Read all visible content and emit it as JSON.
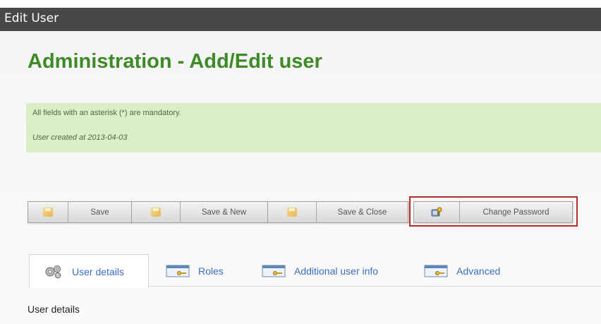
{
  "window": {
    "title": "Edit User"
  },
  "page": {
    "title": "Administration - Add/Edit user",
    "notice": {
      "mandatory_text": "All fields with an asterisk (*) are mandatory.",
      "created_text": "User created at 2013-04-03"
    }
  },
  "toolbar": {
    "buttons": [
      {
        "label": "Save",
        "icon": "save-icon"
      },
      {
        "label": "Save & New",
        "icon": "save-icon"
      },
      {
        "label": "Save & Close",
        "icon": "save-icon"
      },
      {
        "label": "Change Password",
        "icon": "key-icon"
      }
    ],
    "highlight_color": "#b52a2a"
  },
  "tabs": [
    {
      "label": "User details",
      "icon": "gears-icon",
      "active": true
    },
    {
      "label": "Roles",
      "icon": "key-card-icon",
      "active": false
    },
    {
      "label": "Additional user info",
      "icon": "key-card-icon",
      "active": false
    },
    {
      "label": "Advanced",
      "icon": "key-card-icon",
      "active": false
    }
  ],
  "section": {
    "label": "User details"
  },
  "colors": {
    "title_green": "#3d8a27",
    "notice_bg": "#dceec9",
    "tab_text": "#3a6ec3",
    "titlebar_bg": "#474747"
  }
}
